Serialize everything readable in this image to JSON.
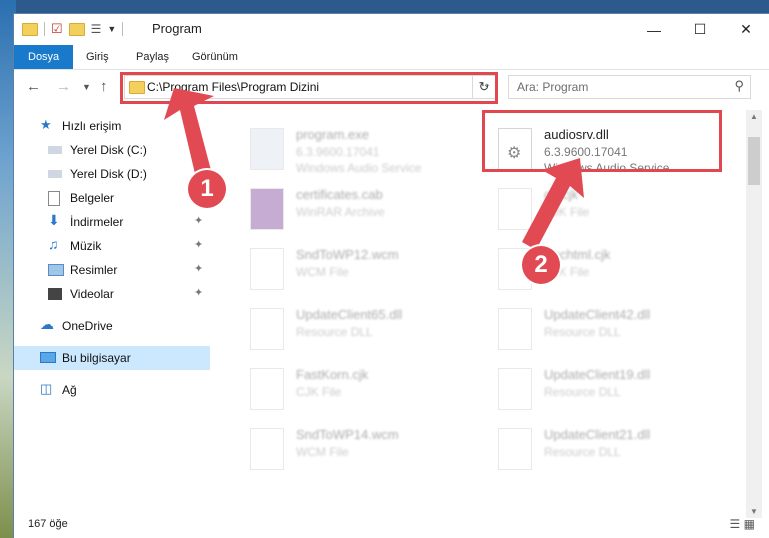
{
  "window": {
    "title": "Program"
  },
  "ribbon": {
    "tabs": [
      "Dosya",
      "Giriş",
      "Paylaş",
      "Görünüm"
    ]
  },
  "address": {
    "path": "C:\\Program Files\\Program Dizini"
  },
  "search": {
    "placeholder": "Ara: Program"
  },
  "sidebar": {
    "items": [
      {
        "label": "Hızlı erişim",
        "icon": "star-icon"
      },
      {
        "label": "Yerel Disk (C:)",
        "icon": "drive-icon"
      },
      {
        "label": "Yerel Disk (D:)",
        "icon": "drive-icon"
      },
      {
        "label": "Belgeler",
        "icon": "documents-icon"
      },
      {
        "label": "İndirmeler",
        "icon": "download-icon"
      },
      {
        "label": "Müzik",
        "icon": "music-icon"
      },
      {
        "label": "Resimler",
        "icon": "pictures-icon"
      },
      {
        "label": "Videolar",
        "icon": "videos-icon"
      },
      {
        "label": "OneDrive",
        "icon": "cloud-icon"
      },
      {
        "label": "Bu bilgisayar",
        "icon": "computer-icon"
      },
      {
        "label": "Ağ",
        "icon": "network-icon"
      }
    ]
  },
  "files": {
    "highlighted": {
      "name": "audiosrv.dll",
      "version": "6.3.9600.17041",
      "desc": "Windows Audio Service"
    },
    "blurred": [
      {
        "name": "program.exe",
        "sub1": "6.3.9600.17041",
        "sub2": "Windows Audio Service"
      },
      {
        "name": "certificates.cab",
        "sub1": "WinRAR Archive",
        "sub2": ""
      },
      {
        "name": "gb.cjk",
        "sub1": "CJK File",
        "sub2": ""
      },
      {
        "name": "SndToWP12.wcm",
        "sub1": "WCM File",
        "sub2": ""
      },
      {
        "name": "Euchtml.cjk",
        "sub1": "CJK File",
        "sub2": ""
      },
      {
        "name": "UpdateClient65.dll",
        "sub1": "Resource DLL",
        "sub2": ""
      },
      {
        "name": "UpdateClient42.dll",
        "sub1": "Resource DLL",
        "sub2": ""
      },
      {
        "name": "FastKorn.cjk",
        "sub1": "CJK File",
        "sub2": ""
      },
      {
        "name": "UpdateClient19.dll",
        "sub1": "Resource DLL",
        "sub2": ""
      },
      {
        "name": "SndToWP14.wcm",
        "sub1": "WCM File",
        "sub2": ""
      },
      {
        "name": "UpdateClient21.dll",
        "sub1": "Resource DLL",
        "sub2": ""
      }
    ]
  },
  "annotations": {
    "badge1": "1",
    "badge2": "2",
    "color": "#e14a52"
  },
  "status": {
    "count": "167 öğe"
  }
}
